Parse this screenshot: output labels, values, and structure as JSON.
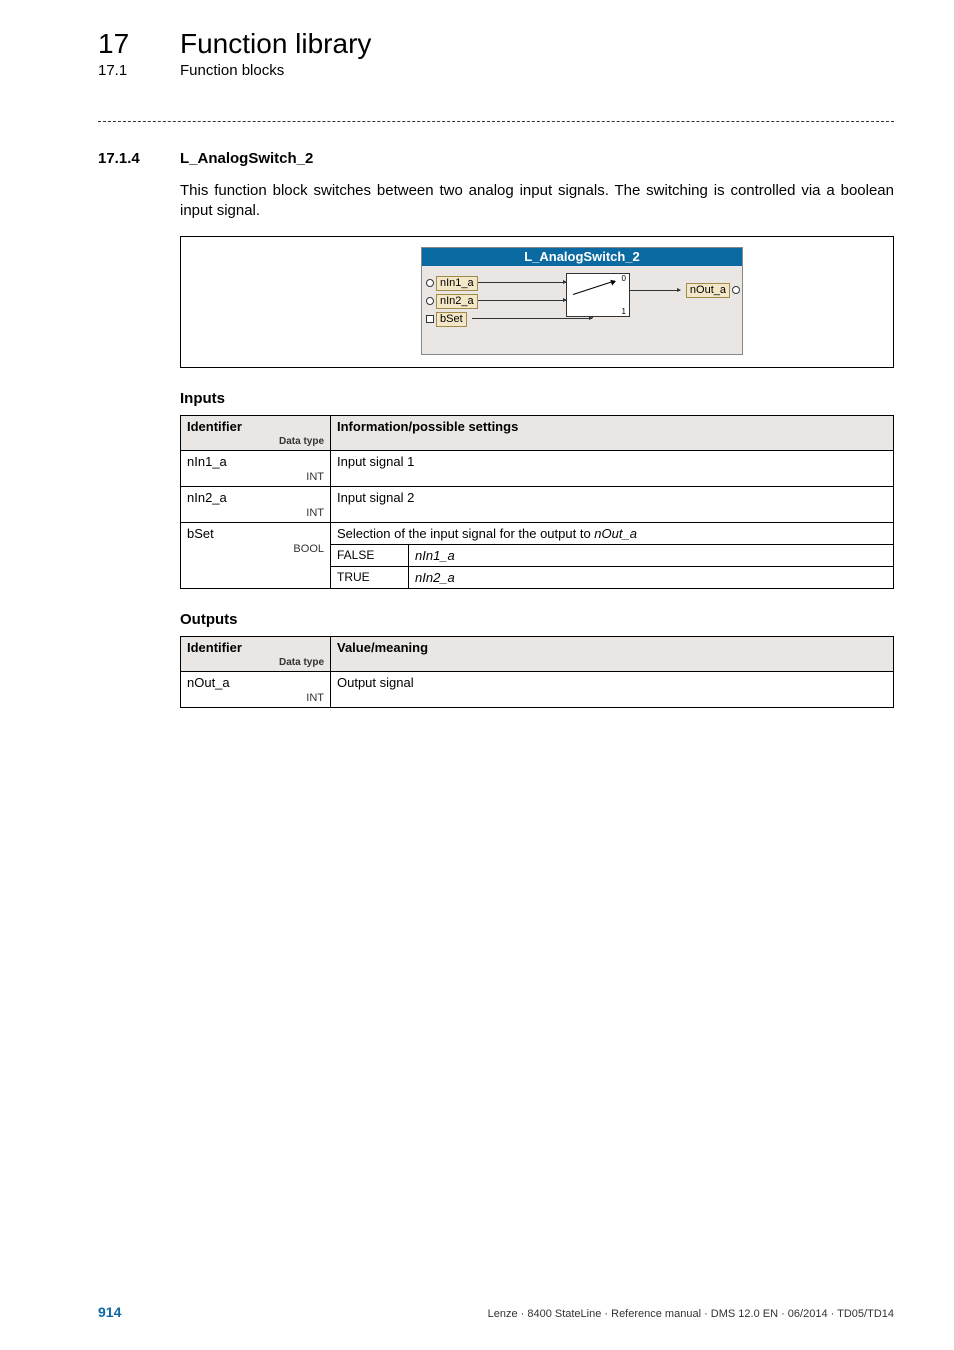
{
  "header": {
    "chapter_number": "17",
    "chapter_title": "Function library",
    "section_number": "17.1",
    "section_title": "Function blocks"
  },
  "section": {
    "number": "17.1.4",
    "title": "L_AnalogSwitch_2",
    "intro": "This function block switches between two analog input signals. The switching is controlled via a boolean input signal."
  },
  "diagram": {
    "block_title": "L_AnalogSwitch_2",
    "ports": {
      "in1": "nIn1_a",
      "in2": "nIn2_a",
      "bset": "bSet",
      "out": "nOut_a"
    },
    "switch_labels": {
      "top": "0",
      "bottom": "1"
    }
  },
  "inputs_table": {
    "heading": "Inputs",
    "header_identifier": "Identifier",
    "header_datatype": "Data type",
    "header_info": "Information/possible settings",
    "rows": {
      "in1": {
        "name": "nIn1_a",
        "type": "INT",
        "info": "Input signal 1"
      },
      "in2": {
        "name": "nIn2_a",
        "type": "INT",
        "info": "Input signal 2"
      },
      "bset": {
        "name": "bSet",
        "type": "BOOL",
        "info": "Selection of the input signal for the output to ",
        "info_ital": "nOut_a",
        "map": {
          "false_label": "FALSE",
          "false_val": "nIn1_a",
          "true_label": "TRUE",
          "true_val": "nIn2_a"
        }
      }
    }
  },
  "outputs_table": {
    "heading": "Outputs",
    "header_identifier": "Identifier",
    "header_datatype": "Data type",
    "header_info": "Value/meaning",
    "rows": {
      "out": {
        "name": "nOut_a",
        "type": "INT",
        "info": "Output signal"
      }
    }
  },
  "footer": {
    "page": "914",
    "line": "Lenze · 8400 StateLine · Reference manual · DMS 12.0 EN · 06/2014 · TD05/TD14"
  }
}
